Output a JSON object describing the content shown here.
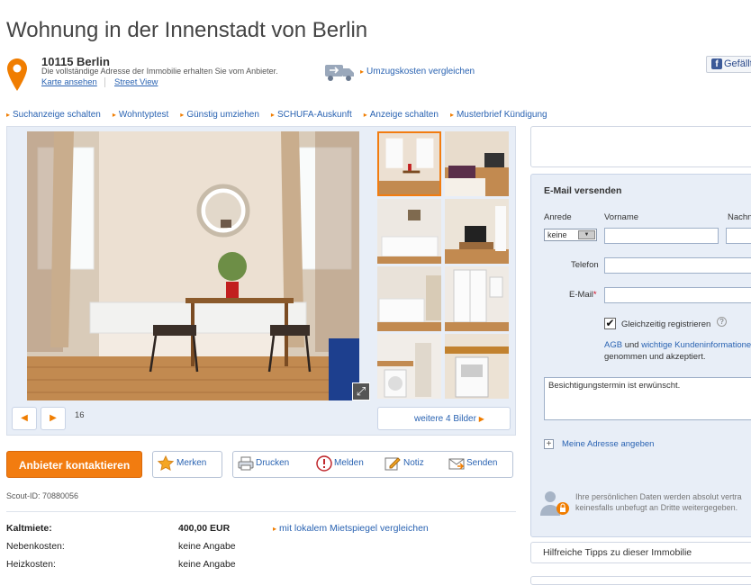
{
  "page": {
    "title": "Wohnung in der Innenstadt von Berlin"
  },
  "address": {
    "city": "10115 Berlin",
    "note": "Die vollständige Adresse der Immobilie erhalten Sie vom Anbieter.",
    "map_link": "Karte ansehen",
    "streetview_link": "Street View"
  },
  "moving": {
    "link": "Umzugskosten vergleichen"
  },
  "facebook": {
    "label": "Gefällt"
  },
  "quicklinks": [
    "Suchanzeige schalten",
    "Wohntyptest",
    "Günstig umziehen",
    "SCHUFA-Auskunft",
    "Anzeige schalten",
    "Musterbrief Kündigung"
  ],
  "gallery": {
    "count": "16",
    "more_label": "weitere 4 Bilder",
    "prev_icon": "◀",
    "next_icon": "▶"
  },
  "actions": {
    "contact": "Anbieter kontaktieren",
    "remember": "Merken",
    "print": "Drucken",
    "report": "Melden",
    "note": "Notiz",
    "send": "Senden"
  },
  "scout_id": "Scout-ID: 70880056",
  "prices": {
    "rows": [
      {
        "label": "Kaltmiete:",
        "value": "400,00 EUR"
      },
      {
        "label": "Nebenkosten:",
        "value": "keine Angabe"
      },
      {
        "label": "Heizkosten:",
        "value": "keine Angabe"
      }
    ],
    "mietspiegel_link": "mit lokalem Mietspiegel vergleichen"
  },
  "form": {
    "title": "E-Mail versenden",
    "anrede_label": "Anrede",
    "anrede_value": "keine",
    "vorname_label": "Vorname",
    "nachname_label": "Nachn",
    "telefon_label": "Telefon",
    "email_label": "E-Mail",
    "register_label": "Gleichzeitig registrieren",
    "agb_text1": "AGB",
    "agb_text2": " und ",
    "agb_text3": "wichtige Kundeninformationen",
    "agb_text4": "genommen und akzeptiert.",
    "message": "Besichtigungstermin ist erwünscht.",
    "add_address": "Meine Adresse angeben",
    "privacy_line1": "Ihre persönlichen Daten werden absolut vertra",
    "privacy_line2": "keinesfalls unbefugt an Dritte weitergegeben."
  },
  "sidebar": {
    "tips": "Hilfreiche Tipps zu dieser Immobilie"
  },
  "colors": {
    "accent": "#f27c10",
    "link": "#2a63b2",
    "panel": "#e8eef7"
  }
}
